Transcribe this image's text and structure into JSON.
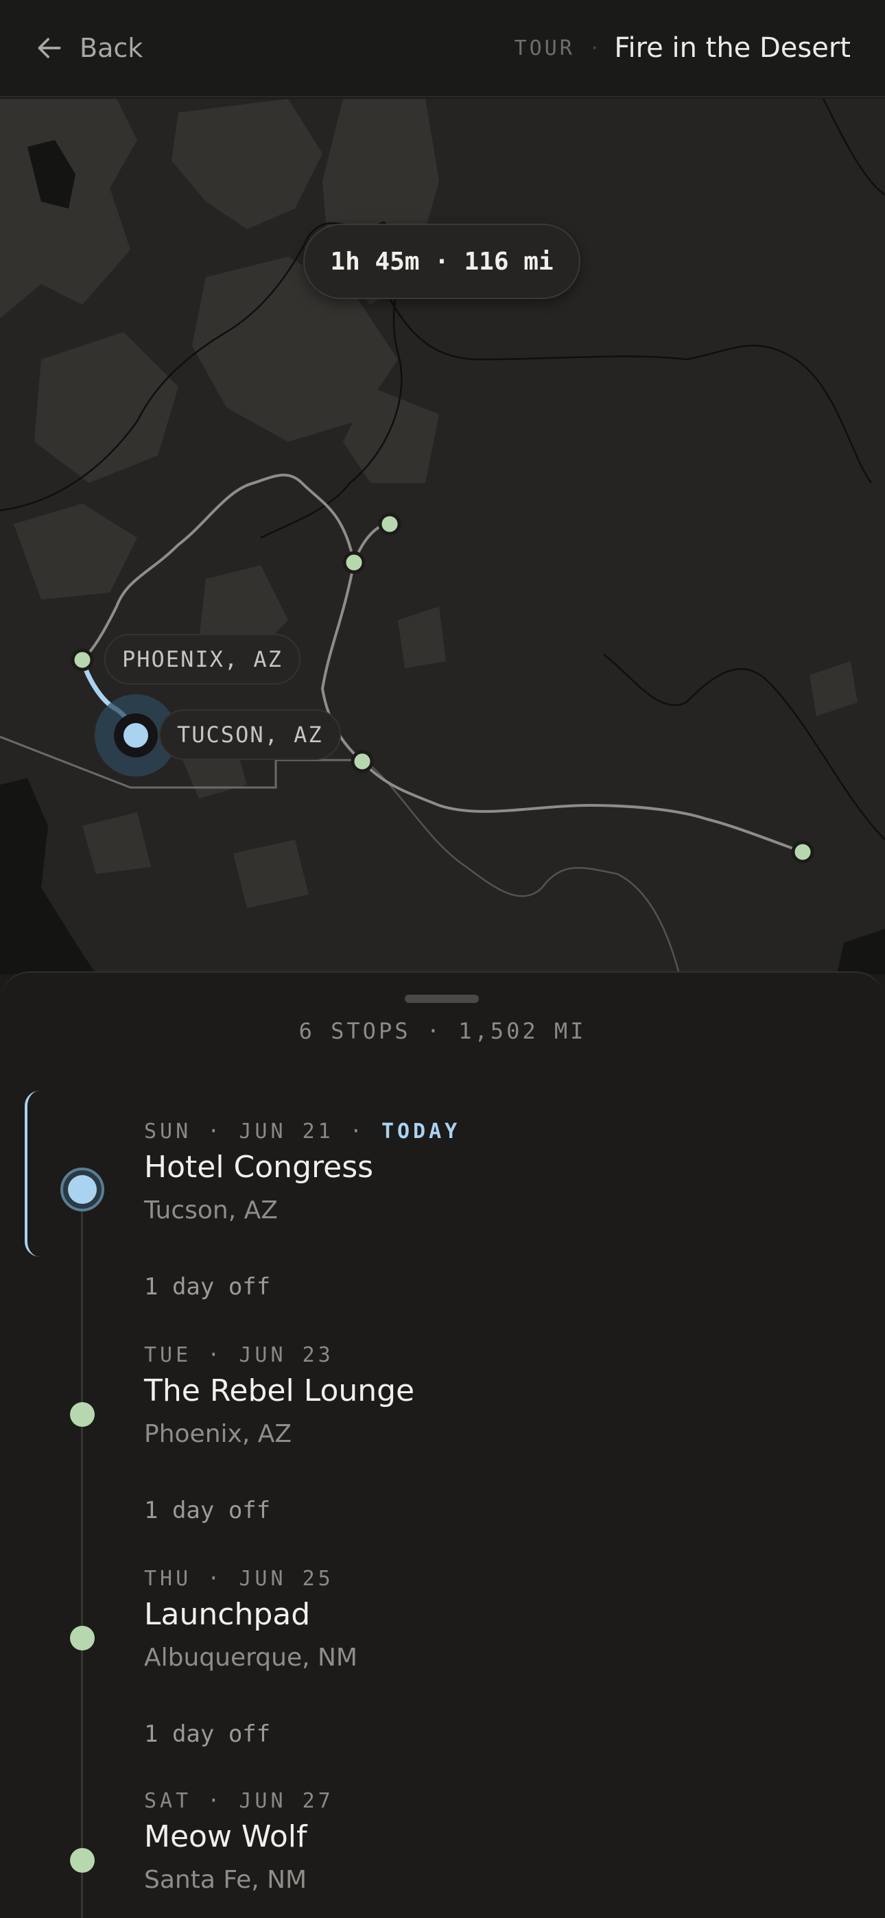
{
  "header": {
    "back_label": "Back",
    "tour_label": "TOUR",
    "separator": "·",
    "tour_name": "Fire in the Desert"
  },
  "map": {
    "route_info": "1h 45m · 116 mi",
    "labels": {
      "phoenix": "PHOENIX, AZ",
      "tucson": "TUCSON, AZ"
    },
    "colors": {
      "route_active": "#a9d3f1",
      "route": "#8f8d88",
      "stop_marker": "#b7d8ae"
    }
  },
  "sheet": {
    "summary": "6 STOPS · 1,502 MI",
    "stops": [
      {
        "date": "SUN · JUN 21 · ",
        "today": "TODAY",
        "name": "Hotel Congress",
        "city": "Tucson, AZ",
        "active": true
      },
      {
        "date": "TUE · JUN 23",
        "name": "The Rebel Lounge",
        "city": "Phoenix, AZ"
      },
      {
        "date": "THU · JUN 25",
        "name": "Launchpad",
        "city": "Albuquerque, NM"
      },
      {
        "date": "SAT · JUN 27",
        "name": "Meow Wolf",
        "city": "Santa Fe, NM"
      }
    ],
    "gaps": [
      "1 day off",
      "1 day off",
      "1 day off"
    ]
  }
}
